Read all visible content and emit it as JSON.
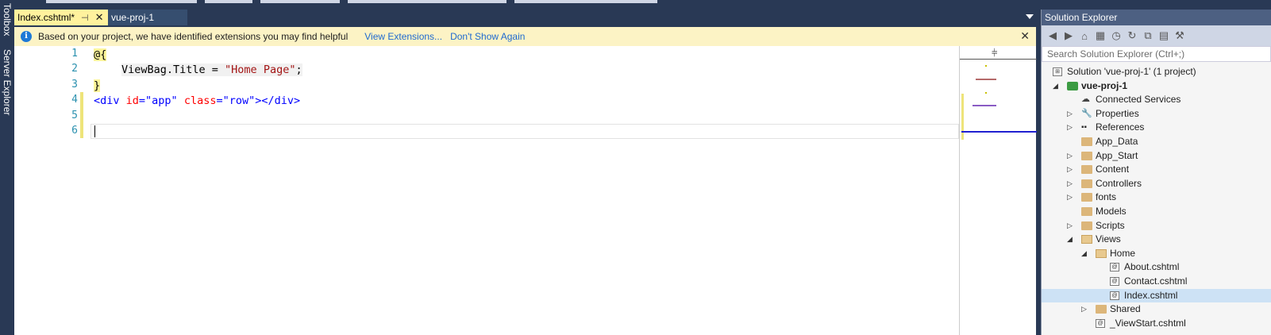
{
  "side_strip": {
    "toolbox_label": "Toolbox",
    "server_explorer_label": "Server Explorer"
  },
  "tabs": {
    "active": {
      "label": "Index.cshtml*",
      "pin_icon": "pin-icon",
      "close_icon": "close-icon"
    },
    "inactive": {
      "label": "vue-proj-1"
    }
  },
  "infobar": {
    "message": "Based on your project, we have identified extensions you may find helpful",
    "view_extensions": "View Extensions...",
    "dont_show": "Don't Show Again",
    "close_glyph": "✕"
  },
  "editor": {
    "line_numbers": [
      "1",
      "2",
      "3",
      "4",
      "5",
      "6"
    ],
    "lines": {
      "l1": "@{",
      "l2_a": "ViewBag.Title = ",
      "l2_str": "\"Home Page\"",
      "l2_semi": ";",
      "l3": "}",
      "l4_open": "<div ",
      "l4_attr1": "id",
      "l4_eq1": "=",
      "l4_val1": "\"app\"",
      "l4_attr2": "class",
      "l4_eq2": "=",
      "l4_val2": "\"row\"",
      "l4_close": "></div>"
    }
  },
  "solution_explorer": {
    "title": "Solution Explorer",
    "search_placeholder": "Search Solution Explorer (Ctrl+;)",
    "solution": "Solution 'vue-proj-1' (1 project)",
    "project": "vue-proj-1",
    "items": [
      "Connected Services",
      "Properties",
      "References",
      "App_Data",
      "App_Start",
      "Content",
      "Controllers",
      "fonts",
      "Models",
      "Scripts",
      "Views",
      "Home",
      "About.cshtml",
      "Contact.cshtml",
      "Index.cshtml",
      "Shared",
      "_ViewStart.cshtml"
    ]
  },
  "colors": {
    "accent": "#293955",
    "active_tab": "#fff29d",
    "infobar": "#fcf3c5",
    "keyword": "#0000ff",
    "string": "#a31515",
    "attr": "#ff0000"
  }
}
